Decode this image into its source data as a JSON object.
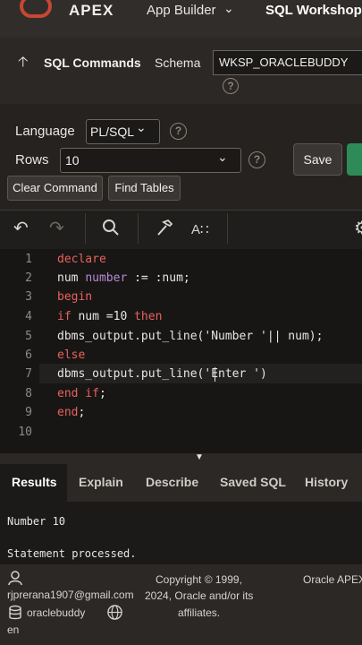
{
  "topbar": {
    "title": "APEX",
    "app_builder": "App Builder",
    "sql_workshop": "SQL Workshop"
  },
  "header": {
    "page_title": "SQL Commands",
    "schema_label": "Schema",
    "schema_value": "WKSP_ORACLEBUDDY"
  },
  "options": {
    "language_label": "Language",
    "language_value": "PL/SQL",
    "rows_label": "Rows",
    "rows_value": "10",
    "save_label": "Save",
    "clear_label": "Clear Command",
    "find_label": "Find Tables"
  },
  "editor": {
    "line_numbers": [
      "1",
      "2",
      "3",
      "4",
      "5",
      "6",
      "7",
      "8",
      "9",
      "10"
    ]
  },
  "tabs": [
    "Results",
    "Explain",
    "Describe",
    "Saved SQL",
    "History"
  ],
  "results": {
    "line1": "Number 10",
    "line2": "Statement processed."
  },
  "footer": {
    "email": "rjprerana1907@gmail.com",
    "workspace": "oraclebuddy",
    "lang": "en",
    "copyright_1": "Copyright © 1999,",
    "copyright_2": "2024, Oracle and/or its",
    "copyright_3": "affiliates.",
    "product": "Oracle APEX"
  },
  "colors": {
    "brand_red": "#c74634",
    "keyword": "#e8625a",
    "type": "#b98ad6",
    "run_green": "#2e8b57"
  }
}
